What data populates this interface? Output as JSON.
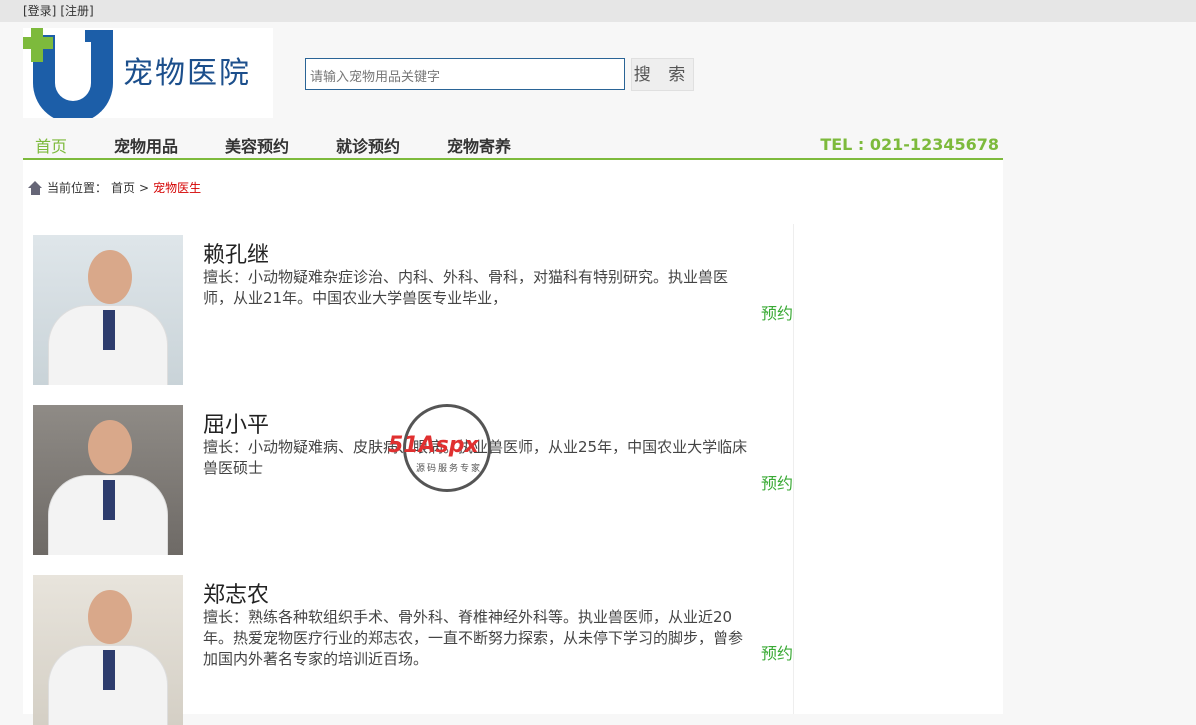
{
  "topbar": {
    "login": "[登录]",
    "register": "[注册]"
  },
  "logo": {
    "title": "宠物医院"
  },
  "search": {
    "placeholder": "请输入宠物用品关键字",
    "button": "搜 索"
  },
  "nav": {
    "items": [
      "首页",
      "宠物用品",
      "美容预约",
      "就诊预约",
      "宠物寄养"
    ],
    "tel": "TEL : 021-12345678"
  },
  "breadcrumb": {
    "label": "当前位置：",
    "home": "首页",
    "sep": ">",
    "current": "宠物医生"
  },
  "doctors": [
    {
      "name": "赖孔继",
      "desc": "擅长：小动物疑难杂症诊治、内科、外科、骨科，对猫科有特别研究。执业兽医师，从业21年。中国农业大学兽医专业毕业，",
      "action": "预约"
    },
    {
      "name": "屈小平",
      "desc": "擅长：小动物疑难病、皮肤病、眼病。执业兽医师，从业25年，中国农业大学临床兽医硕士",
      "action": "预约"
    },
    {
      "name": "郑志农",
      "desc": "擅长：熟练各种软组织手术、骨外科、脊椎神经外科等。执业兽医师，从业近20年。热爱宠物医疗行业的郑志农，一直不断努力探索，从未停下学习的脚步，曾参加国内外著名专家的培训近百场。",
      "action": "预约"
    }
  ],
  "watermark": {
    "brand": "51Aspx",
    "slogan": "源码服务专家"
  },
  "colors": {
    "accent": "#7dba3c",
    "brand": "#1c5ea8",
    "current": "#d40000",
    "book": "#3aaa35"
  }
}
